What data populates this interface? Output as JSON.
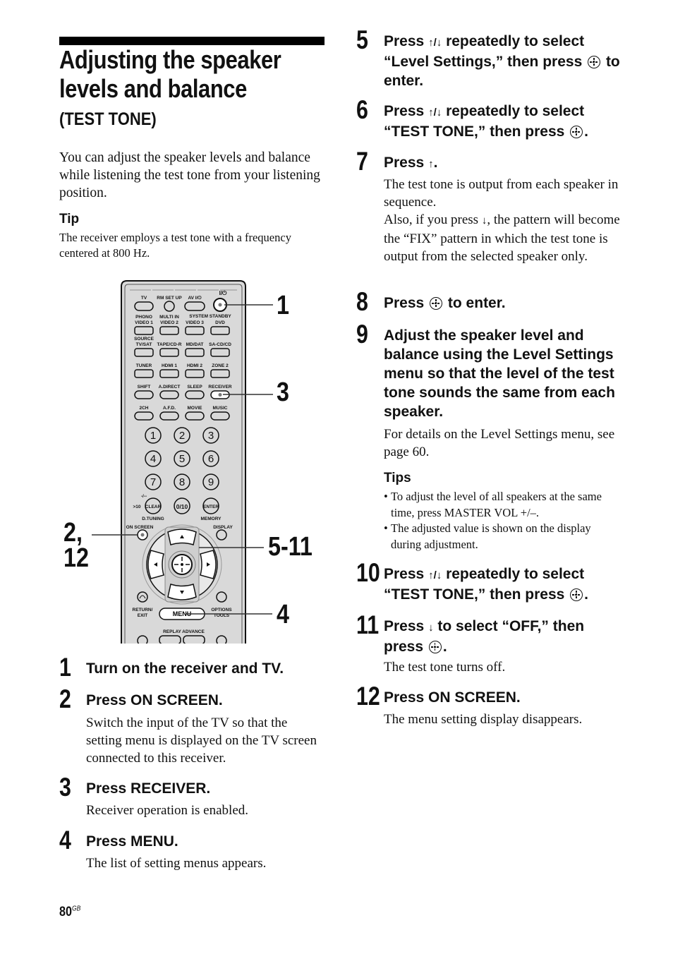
{
  "header": {
    "title_line1": "Adjusting the speaker",
    "title_line2": "levels and balance",
    "subtitle": "(TEST TONE)"
  },
  "intro": "You can adjust the speaker levels and balance while listening the test tone from your listening position.",
  "tip": {
    "heading": "Tip",
    "body": "The receiver employs a test tone with a frequency centered at 800 Hz."
  },
  "figure": {
    "callouts": {
      "power": "1",
      "receiver": "3",
      "on_screen_a": "2,",
      "on_screen_b": "12",
      "navigation": "5-11",
      "menu": "4"
    },
    "remote": {
      "row1": [
        "TV",
        "RM SET UP",
        "AV I/⏻",
        "I/⏻"
      ],
      "row2_top": [
        "PHONO",
        "MULTI IN",
        "SYSTEM STANDBY",
        ""
      ],
      "row2": [
        "VIDEO 1",
        "VIDEO 2",
        "VIDEO 3",
        "DVD"
      ],
      "row3_top": "SOURCE",
      "row3": [
        "TV/SAT",
        "TAPE/CD-R",
        "MD/DAT",
        "SA-CD/CD"
      ],
      "row4": [
        "TUNER",
        "HDMI 1",
        "HDMI 2",
        "ZONE 2"
      ],
      "row5": [
        "SHIFT",
        "A.DIRECT",
        "SLEEP",
        "RECEIVER"
      ],
      "row6": [
        "2CH",
        "A.F.D.",
        "MOVIE",
        "MUSIC"
      ],
      "numpad": [
        "1",
        "2",
        "3",
        "4",
        "5",
        "6",
        "7",
        "8",
        "9"
      ],
      "clear": "CLEAR",
      "zero": "0/10",
      "enter": "ENTER",
      "dash": "-/--",
      "gt10": ">10",
      "d_tuning": "D.TUNING",
      "memory": "MEMORY",
      "on_screen": "ON SCREEN",
      "display": "DISPLAY",
      "return_exit_1": "RETURN/",
      "return_exit_2": "EXIT",
      "menu": "MENU",
      "options_1": "OPTIONS",
      "options_2": "TOOLS",
      "replay": "REPLAY",
      "advance": "ADVANCE"
    }
  },
  "steps": [
    {
      "num": "1",
      "title": "Turn on the receiver and TV.",
      "body": ""
    },
    {
      "num": "2",
      "title": "Press ON SCREEN.",
      "body": "Switch the input of the TV so that the setting menu is displayed on the TV screen connected to this receiver."
    },
    {
      "num": "3",
      "title": "Press RECEIVER.",
      "body": "Receiver operation is enabled."
    },
    {
      "num": "4",
      "title": "Press MENU.",
      "body": "The list of setting menus appears."
    },
    {
      "num": "5",
      "title_a": "Press",
      "title_arrows": "↑/↓",
      "title_b": "repeatedly to select “Level Settings,” then press",
      "title_c": "to enter."
    },
    {
      "num": "6",
      "title_a": "Press",
      "title_arrows": "↑/↓",
      "title_b": "repeatedly to select “TEST TONE,” then press",
      "title_c": "."
    },
    {
      "num": "7",
      "title_a": "Press",
      "title_arrows": "↑",
      "title_c": ".",
      "body_a": "The test tone is output from each speaker in sequence.",
      "body_b": "Also, if you press",
      "body_arrow": "↓",
      "body_c": ", the pattern will become the “FIX” pattern in which the test tone is output from the selected speaker only."
    },
    {
      "num": "8",
      "title_a": "Press",
      "title_c": "to enter."
    },
    {
      "num": "9",
      "title": "Adjust the speaker level and balance using the Level Settings menu so that the level of the test tone sounds the same from each speaker.",
      "body": "For details on the Level Settings menu, see page 60."
    },
    {
      "num": "10",
      "title_a": "Press",
      "title_arrows": "↑/↓",
      "title_b": "repeatedly to select “TEST TONE,” then press",
      "title_c": "."
    },
    {
      "num": "11",
      "title_a": "Press",
      "title_arrows": "↓",
      "title_b": "to select “OFF,” then press",
      "title_c": ".",
      "body": "The test tone turns off."
    },
    {
      "num": "12",
      "title": "Press ON SCREEN.",
      "body": "The menu setting display disappears."
    }
  ],
  "tips": {
    "heading": "Tips",
    "items": [
      "To adjust the level of all speakers at the same time, press MASTER VOL +/–.",
      "The adjusted value is shown on the display during adjustment."
    ]
  },
  "footer": {
    "page": "80",
    "suffix": "GB"
  }
}
